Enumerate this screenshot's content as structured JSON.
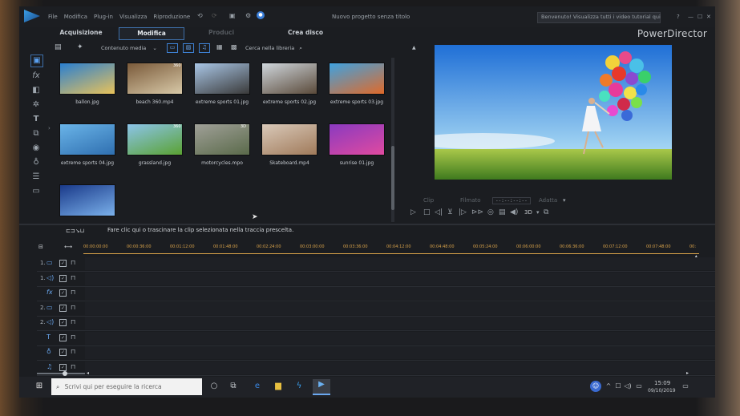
{
  "menu": [
    "File",
    "Modifica",
    "Plug-in",
    "Visualizza",
    "Riproduzione"
  ],
  "project_title": "Nuovo progetto senza titolo",
  "tutorial_text": "Benvenuto! Visualizza tutti i video tutorial qui",
  "window_controls": [
    "?",
    "—",
    "☐",
    "✕"
  ],
  "tabs": [
    "Acquisizione",
    "Modifica",
    "Produci",
    "Crea disco"
  ],
  "active_tab": "Modifica",
  "brand": "PowerDirector",
  "library": {
    "filter": "Contenuto media",
    "search_placeholder": "Cerca nella libreria",
    "items": [
      {
        "name": "ballon.jpg",
        "badge": "",
        "c1": "#2a7fd0",
        "c2": "#e8c25a"
      },
      {
        "name": "beach 360.mp4",
        "badge": "360",
        "c1": "#7a5a3a",
        "c2": "#d8c9a8"
      },
      {
        "name": "extreme sports 01.jpg",
        "badge": "",
        "c1": "#a9c6e6",
        "c2": "#3a3a3a"
      },
      {
        "name": "extreme sports 02.jpg",
        "badge": "",
        "c1": "#cfd6dc",
        "c2": "#5a4a3a"
      },
      {
        "name": "extreme sports 03.jpg",
        "badge": "",
        "c1": "#3fa2e0",
        "c2": "#e06a2a"
      },
      {
        "name": "extreme sports 04.jpg",
        "badge": "",
        "c1": "#6ab4e8",
        "c2": "#2f6fb0"
      },
      {
        "name": "grassland.jpg",
        "badge": "360",
        "c1": "#8cc4ea",
        "c2": "#5aa232"
      },
      {
        "name": "motorcycles.mpo",
        "badge": "3D",
        "c1": "#a0a098",
        "c2": "#5a6a4a"
      },
      {
        "name": "Skateboard.mp4",
        "badge": "",
        "c1": "#d9c9b9",
        "c2": "#a07a5a"
      },
      {
        "name": "sunrise 01.jpg",
        "badge": "",
        "c1": "#8a3ac0",
        "c2": "#e04aa0"
      },
      {
        "name": "",
        "badge": "",
        "c1": "#1a3a8a",
        "c2": "#7ab0ea"
      }
    ]
  },
  "preview": {
    "labels": [
      "Clip",
      "Filmato",
      "Adatta"
    ],
    "timecode": "--:--:--:--",
    "mode_3d": "3D"
  },
  "timeline": {
    "hint": "Fare clic qui o trascinare la clip selezionata nella traccia prescelta.",
    "ruler": [
      "00:00:00:00",
      "00:00:36:00",
      "00:01:12:00",
      "00:01:48:00",
      "00:02:24:00",
      "00:03:00:00",
      "00:03:36:00",
      "00:04:12:00",
      "00:04:48:00",
      "00:05:24:00",
      "00:06:00:00",
      "00:06:36:00",
      "00:07:12:00",
      "00:07:48:00",
      "00:"
    ],
    "tracks": [
      {
        "label": "1.",
        "icon": "video-track-icon",
        "glyph": "▭"
      },
      {
        "label": "1.",
        "icon": "audio-track-icon",
        "glyph": "◁)"
      },
      {
        "label": "",
        "icon": "fx-track-icon",
        "glyph": "fx"
      },
      {
        "label": "2.",
        "icon": "video-track-icon",
        "glyph": "▭"
      },
      {
        "label": "2.",
        "icon": "audio-track-icon",
        "glyph": "◁)"
      },
      {
        "label": "",
        "icon": "title-track-icon",
        "glyph": "T"
      },
      {
        "label": "",
        "icon": "voice-track-icon",
        "glyph": "♁"
      },
      {
        "label": "",
        "icon": "music-track-icon",
        "glyph": "♫"
      }
    ]
  },
  "taskbar": {
    "search_placeholder": "Scrivi qui per eseguire la ricerca",
    "time": "15:09",
    "date": "09/10/2019"
  }
}
